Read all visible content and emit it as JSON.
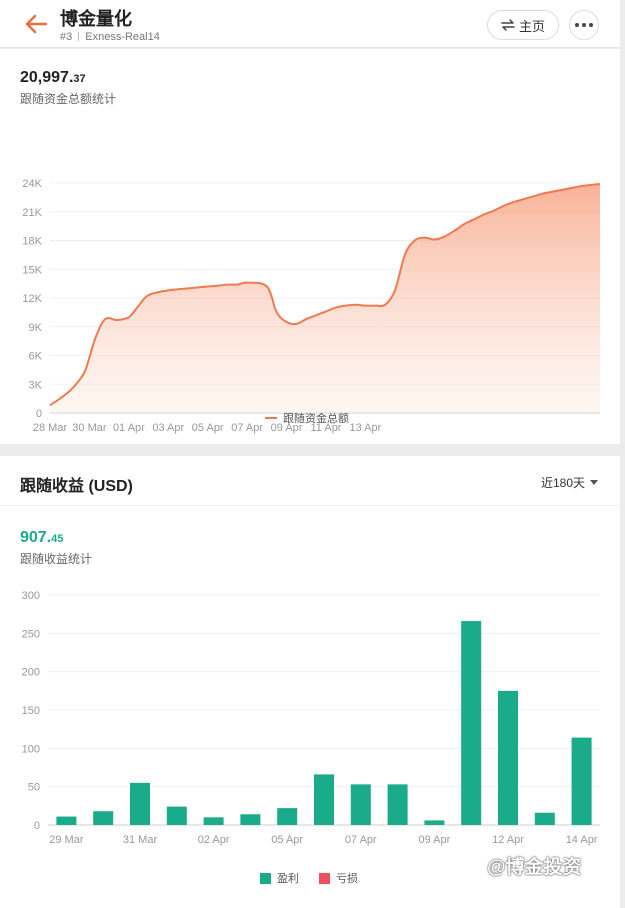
{
  "header": {
    "title": "博金量化",
    "rank": "#3",
    "account": "Exness-Real14",
    "home_label": "主页",
    "home_icon": "swap-icon",
    "more_icon": "more-dots-icon",
    "back_icon": "back-arrow-icon",
    "accent": "#e8703f"
  },
  "equity": {
    "value_int": "20,997.",
    "value_dec": "37",
    "caption": "跟随资金总额统计",
    "legend_label": "跟随资金总额"
  },
  "profit": {
    "section_title": "跟随收益 (USD)",
    "period_label": "近180天",
    "value_int": "907.",
    "value_dec": "45",
    "caption": "跟随收益统计",
    "legend_profit": "盈利",
    "legend_loss": "亏损"
  },
  "watermark": "@博金投资",
  "chart_data": [
    {
      "type": "area",
      "ylim": [
        0,
        24000
      ],
      "y_ticks": [
        "0",
        "3K",
        "6K",
        "9K",
        "12K",
        "15K",
        "18K",
        "21K",
        "24K"
      ],
      "x_tick_labels": [
        "28 Mar",
        "30 Mar",
        "01 Apr",
        "03 Apr",
        "05 Apr",
        "07 Apr",
        "09 Apr",
        "11 Apr",
        "13 Apr"
      ],
      "series": [
        {
          "name": "跟随资金总额",
          "color": "#ee7a4f",
          "x": [
            0,
            0.5,
            1,
            1.4,
            1.8,
            2.3,
            2.8,
            3.4,
            4,
            4.5,
            5,
            6,
            7,
            7.5,
            8,
            8.6,
            9,
            9.5,
            10,
            11,
            11.5,
            12,
            12.5,
            13,
            13.5,
            14,
            14.5,
            15,
            15.5,
            16,
            16.5,
            17,
            17.5,
            18,
            18.5,
            19,
            19.5,
            20,
            20.5,
            21,
            21.5,
            22,
            22.5,
            23,
            23.5,
            24,
            24.5,
            25,
            25.5,
            26,
            26.5,
            27,
            27.5,
            27.9
          ],
          "values": [
            800,
            1500,
            2300,
            3200,
            4500,
            7800,
            9800,
            9700,
            10000,
            11200,
            12300,
            12800,
            13000,
            13100,
            13200,
            13300,
            13400,
            13400,
            13600,
            13200,
            10500,
            9500,
            9300,
            9800,
            10200,
            10600,
            11000,
            11200,
            11300,
            11200,
            11200,
            11300,
            12800,
            16500,
            18000,
            18300,
            18100,
            18400,
            19000,
            19700,
            20200,
            20700,
            21100,
            21600,
            22000,
            22300,
            22600,
            22900,
            23100,
            23300,
            23500,
            23700,
            23800,
            23900
          ]
        }
      ]
    },
    {
      "type": "bar",
      "ylim": [
        0,
        300
      ],
      "y_ticks": [
        "0",
        "50",
        "100",
        "150",
        "200",
        "250",
        "300"
      ],
      "x_tick_labels": [
        "29 Mar",
        "31 Mar",
        "02 Apr",
        "05 Apr",
        "07 Apr",
        "09 Apr",
        "12 Apr",
        "14 Apr"
      ],
      "series": [
        {
          "name": "盈利",
          "color": "#19ab8a",
          "values": [
            11,
            18,
            55,
            24,
            10,
            14,
            22,
            66,
            53,
            53,
            6,
            266,
            175,
            16,
            114
          ]
        },
        {
          "name": "亏损",
          "color": "#ef4f5f",
          "values": []
        }
      ]
    }
  ]
}
